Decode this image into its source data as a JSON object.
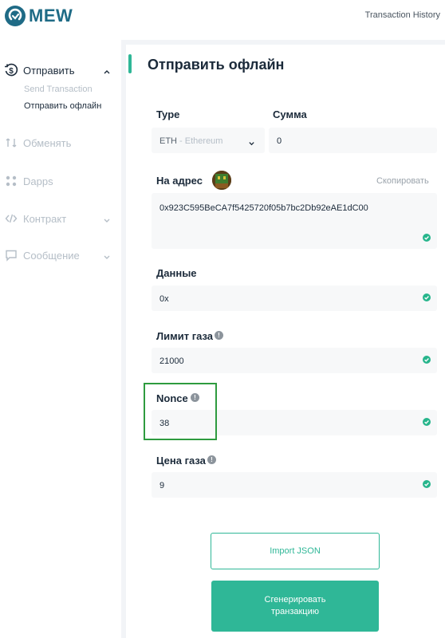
{
  "header": {
    "logo_text": "MEW",
    "history_link": "Transaction History"
  },
  "sidebar": {
    "items": [
      {
        "label": "Отправить",
        "icon": "dollar-circle-icon",
        "expanded": true
      },
      {
        "label": "Обменять",
        "icon": "swap-icon"
      },
      {
        "label": "Dapps",
        "icon": "grid-dots-icon"
      },
      {
        "label": "Контракт",
        "icon": "code-icon"
      },
      {
        "label": "Сообщение",
        "icon": "message-icon"
      }
    ],
    "sub_items": [
      {
        "label": "Send Transaction"
      },
      {
        "label": "Отправить офлайн"
      }
    ]
  },
  "main": {
    "title": "Отправить офлайн",
    "type_label": "Type",
    "type_value_main": "ETH",
    "type_value_sub": " - Ethereum",
    "amount_label": "Сумма",
    "amount_value": "0",
    "to_label": "На адрес",
    "copy_label": "Скопировать",
    "address_value": "0x923C595BeCA7f5425720f05b7bc2Db92eAE1dC00",
    "data_label": "Данные",
    "data_value": "0x",
    "gas_limit_label": "Лимит газа",
    "gas_limit_value": "21000",
    "nonce_label": "Nonce",
    "nonce_value": "38",
    "gas_price_label": "Цена газа",
    "gas_price_value": "9",
    "import_button": "Import JSON",
    "generate_button_line1": "Сгенерировать",
    "generate_button_line2": "транзакцию"
  },
  "colors": {
    "accent": "#2fb797",
    "brand": "#1f6b86",
    "check": "#27b58c",
    "highlight": "#2e9b3f"
  }
}
